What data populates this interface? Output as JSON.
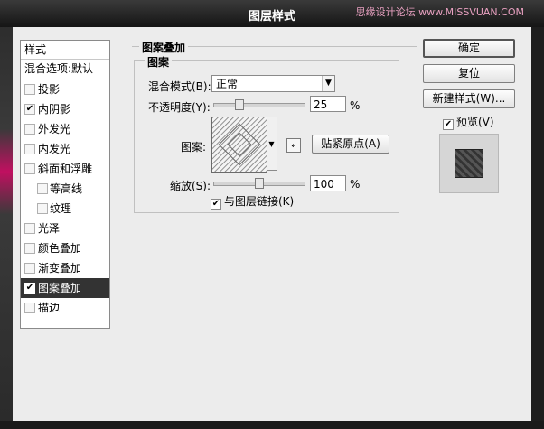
{
  "window": {
    "title": "图层样式",
    "watermark": "思缘设计论坛 www.MISSVUAN.COM"
  },
  "style_list": {
    "header": "样式",
    "blend_options": "混合选项:默认",
    "items": [
      {
        "label": "投影",
        "checked": false,
        "sub": false,
        "active": false
      },
      {
        "label": "内阴影",
        "checked": true,
        "sub": false,
        "active": false
      },
      {
        "label": "外发光",
        "checked": false,
        "sub": false,
        "active": false
      },
      {
        "label": "内发光",
        "checked": false,
        "sub": false,
        "active": false
      },
      {
        "label": "斜面和浮雕",
        "checked": false,
        "sub": false,
        "active": false
      },
      {
        "label": "等高线",
        "checked": false,
        "sub": true,
        "active": false
      },
      {
        "label": "纹理",
        "checked": false,
        "sub": true,
        "active": false
      },
      {
        "label": "光泽",
        "checked": false,
        "sub": false,
        "active": false
      },
      {
        "label": "颜色叠加",
        "checked": false,
        "sub": false,
        "active": false
      },
      {
        "label": "渐变叠加",
        "checked": false,
        "sub": false,
        "active": false
      },
      {
        "label": "图案叠加",
        "checked": true,
        "sub": false,
        "active": true
      },
      {
        "label": "描边",
        "checked": false,
        "sub": false,
        "active": false
      }
    ]
  },
  "panel": {
    "group_title": "图案叠加",
    "subgroup_title": "图案",
    "blend_mode": {
      "label": "混合模式(B):",
      "value": "正常"
    },
    "opacity": {
      "label": "不透明度(Y):",
      "value": "25",
      "unit": "%",
      "level": 0.25
    },
    "pattern": {
      "label": "图案:",
      "snap_button": "贴紧原点(A)"
    },
    "scale": {
      "label": "缩放(S):",
      "value": "100",
      "unit": "%",
      "level": 0.5
    },
    "link_layer": {
      "label": "与图层链接(K)",
      "checked": true
    }
  },
  "buttons": {
    "ok": "确定",
    "reset": "复位",
    "new_style": "新建样式(W)...",
    "preview": {
      "label": "预览(V)",
      "checked": true
    }
  },
  "check_mark": "✔"
}
